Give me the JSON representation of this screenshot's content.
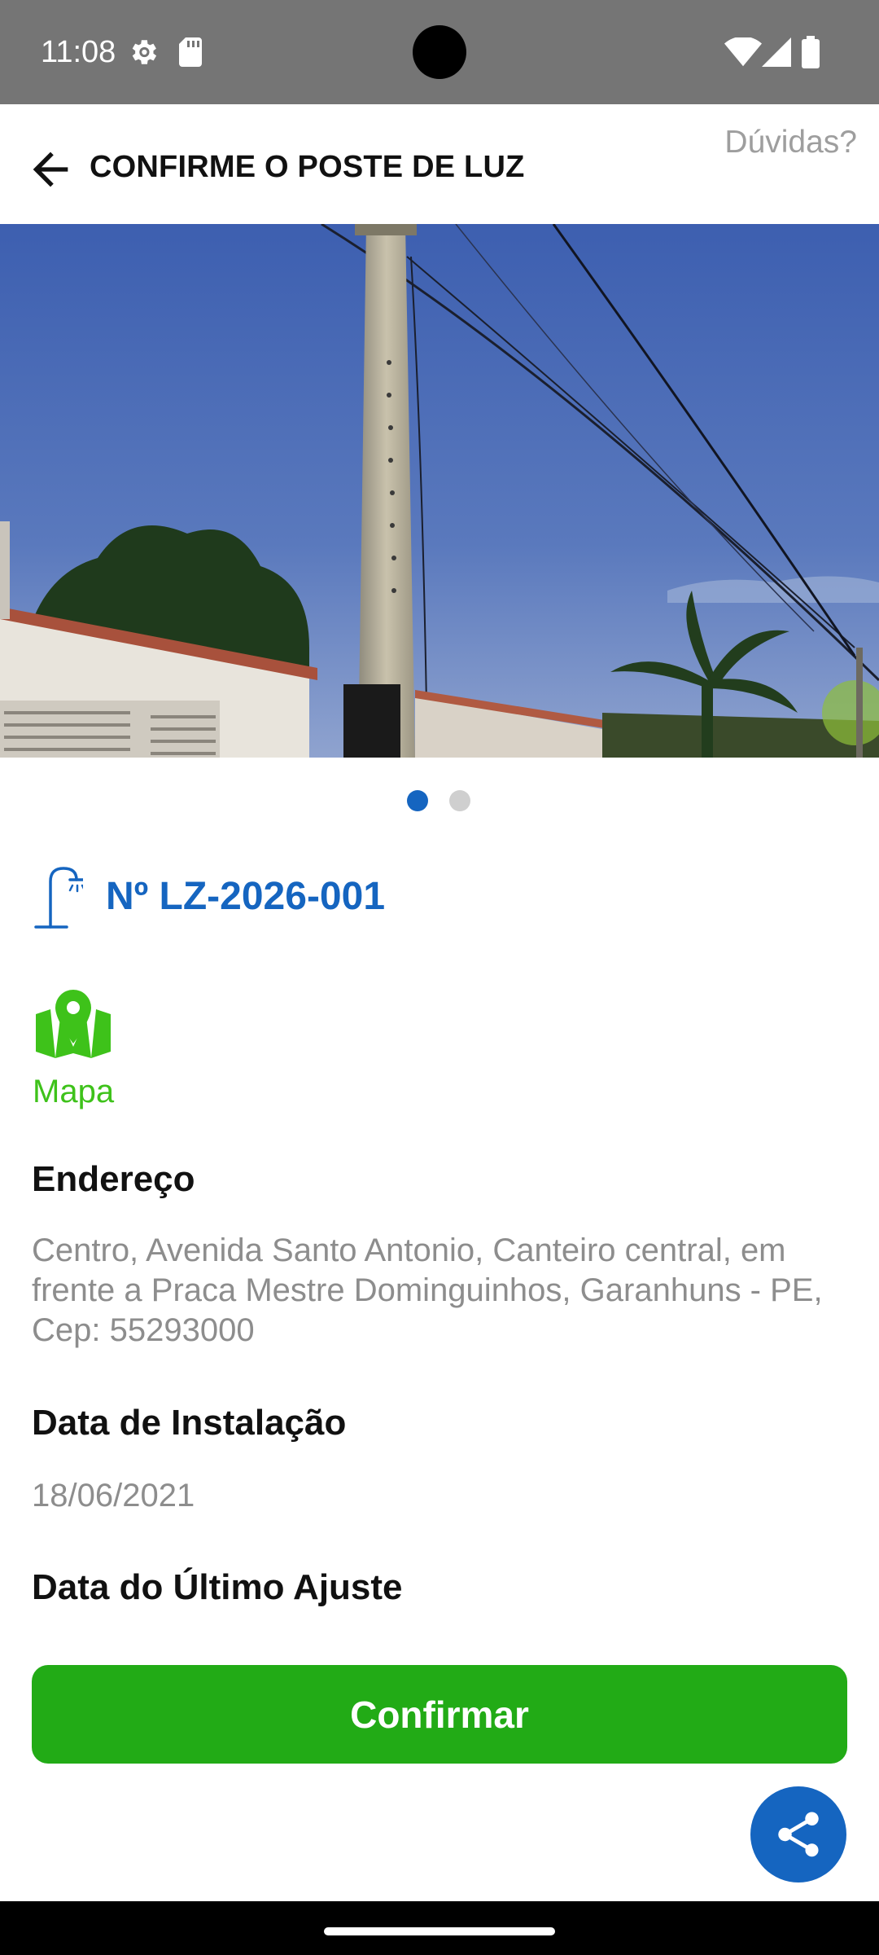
{
  "status_bar": {
    "time": "11:08",
    "icons": [
      "settings-icon",
      "sd-card-icon",
      "wifi-icon",
      "signal-icon",
      "battery-icon"
    ]
  },
  "app_bar": {
    "title": "CONFIRME O POSTE DE LUZ",
    "help_label": "Dúvidas?",
    "back_icon": "arrow-back-icon"
  },
  "gallery": {
    "image": "photo of a concrete utility pole with power lines against an evening sky",
    "pages": 2,
    "current_page": 1
  },
  "pole": {
    "id": "Nº LZ-2026-001",
    "icon": "street-lamp-icon"
  },
  "map": {
    "label": "Mapa",
    "icon": "map-pin-icon"
  },
  "sections": {
    "address_title": "Endereço",
    "address_value": "Centro, Avenida Santo Antonio, Canteiro central, em frente a Praca Mestre Dominguinhos, Garanhuns - PE, Cep: 55293000",
    "install_title": "Data de Instalação",
    "install_value": "18/06/2021",
    "last_adjust_title": "Data do Último Ajuste"
  },
  "actions": {
    "confirm_label": "Confirmar",
    "share_icon": "share-icon"
  },
  "colors": {
    "primary_blue": "#1565c0",
    "confirm_green": "#22ab16",
    "map_green": "#3ec21a",
    "status_bar": "#757575"
  }
}
